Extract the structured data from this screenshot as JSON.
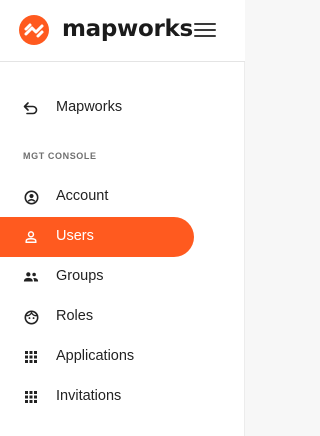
{
  "brand": {
    "name": "mapworks",
    "accent_color": "#ff5a1f",
    "logo_icon": "mapworks-logo-icon"
  },
  "header": {
    "menu_icon": "hamburger-menu-icon"
  },
  "sidebar": {
    "back_item": {
      "label": "Mapworks",
      "icon": "back-arrow-icon"
    },
    "section_title": "MGT CONSOLE",
    "items": [
      {
        "label": "Account",
        "icon": "account-circle-icon",
        "active": false
      },
      {
        "label": "Users",
        "icon": "user-icon",
        "active": true
      },
      {
        "label": "Groups",
        "icon": "group-icon",
        "active": false
      },
      {
        "label": "Roles",
        "icon": "face-icon",
        "active": false
      },
      {
        "label": "Applications",
        "icon": "apps-grid-icon",
        "active": false
      },
      {
        "label": "Invitations",
        "icon": "apps-grid-icon",
        "active": false
      }
    ]
  }
}
